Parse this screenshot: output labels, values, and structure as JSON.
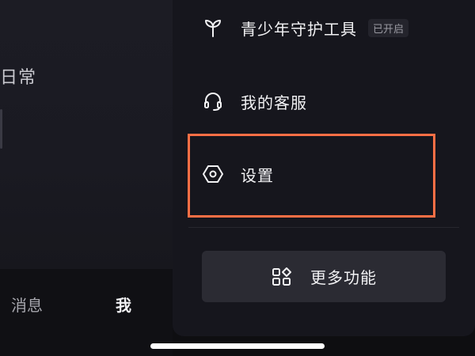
{
  "left_page": {
    "partial_heading": "日常",
    "tabbar": {
      "messages_label": "消息",
      "me_label": "我"
    }
  },
  "drawer": {
    "items": [
      {
        "label": "青少年守护工具",
        "badge": "已开启",
        "icon": "sprout-icon"
      },
      {
        "label": "我的客服",
        "icon": "headset-icon"
      },
      {
        "label": "设置",
        "icon": "hexagon-gear-icon"
      }
    ],
    "more_button": {
      "label": "更多功能",
      "icon": "apps-grid-icon"
    }
  },
  "colors": {
    "drawer_bg": "#16161d",
    "button_bg": "#2b2b33",
    "highlight": "#ff6f45",
    "text": "#f2f2f4"
  }
}
